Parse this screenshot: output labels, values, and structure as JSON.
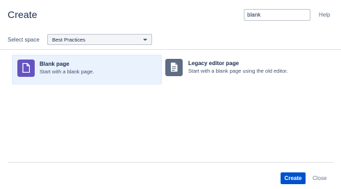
{
  "header": {
    "title": "Create",
    "search_value": "blank",
    "help_label": "Help"
  },
  "space": {
    "label": "Select space",
    "selected": "Best Practices"
  },
  "templates": [
    {
      "name": "Blank page",
      "description": "Start with a blank page.",
      "icon": "page-icon",
      "selected": true,
      "icon_color": "#6554c0"
    },
    {
      "name": "Legacy editor page",
      "description": "Start with a blank page using the old editor.",
      "icon": "page-icon",
      "selected": false,
      "icon_color": "#5e6c84"
    }
  ],
  "footer": {
    "create_label": "Create",
    "close_label": "Close"
  },
  "colors": {
    "primary": "#0052cc",
    "selected_card_bg": "#e9f2fd"
  }
}
